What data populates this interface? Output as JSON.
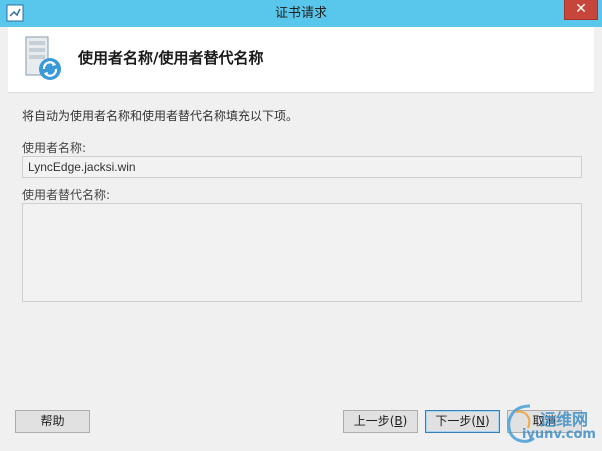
{
  "window": {
    "title": "证书请求",
    "close_label": "✕"
  },
  "header": {
    "title": "使用者名称/使用者替代名称",
    "icon": "certificate-server-icon"
  },
  "content": {
    "instruction": "将自动为使用者名称和使用者替代名称填充以下项。",
    "subject_label": "使用者名称:",
    "subject_value": "LyncEdge.jacksi.win",
    "alt_label": "使用者替代名称:",
    "alt_value": ""
  },
  "buttons": {
    "help": "帮助",
    "back": "上一步",
    "back_key": "B",
    "next": "下一步",
    "next_key": "N",
    "cancel": "取消"
  },
  "watermark": {
    "top": "运维网",
    "bottom": "iyunv.com"
  },
  "colors": {
    "titlebar": "#59c6eb",
    "close": "#c7463b",
    "accent": "#3c7fb1"
  }
}
